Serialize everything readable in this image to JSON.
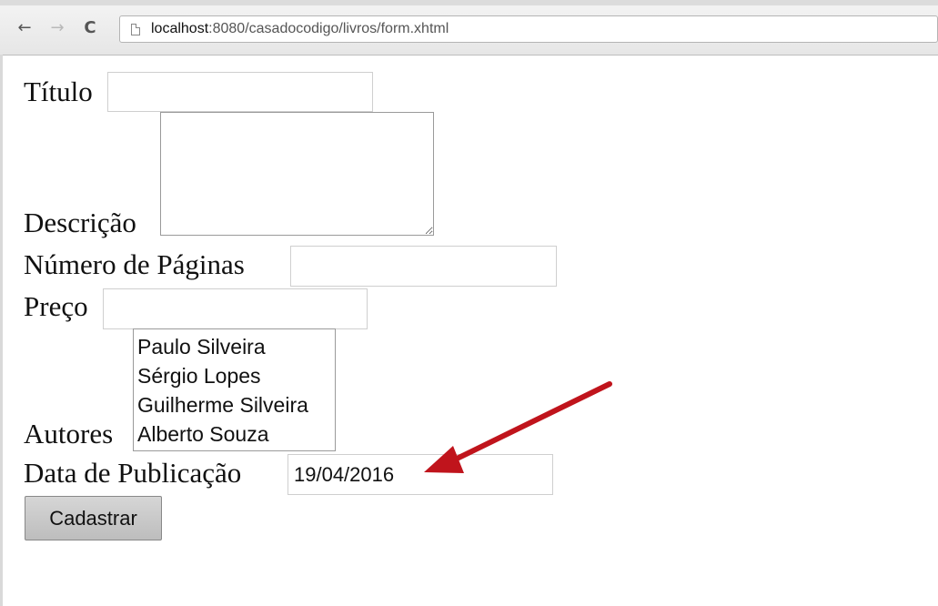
{
  "browser": {
    "back_icon": "←",
    "forward_icon": "→",
    "reload_icon": "C",
    "url_host": "localhost",
    "url_path": ":8080/casadocodigo/livros/form.xhtml"
  },
  "form": {
    "titulo_label": "Título",
    "titulo_value": "",
    "descricao_label": "Descrição",
    "descricao_value": "",
    "numero_paginas_label": "Número de Páginas",
    "numero_paginas_value": "",
    "preco_label": "Preço",
    "preco_value": "",
    "autores_label": "Autores",
    "autores_options": [
      "Paulo Silveira",
      "Sérgio Lopes",
      "Guilherme Silveira",
      "Alberto Souza"
    ],
    "data_publicacao_label": "Data de Publicação",
    "data_publicacao_value": "19/04/2016",
    "submit_label": "Cadastrar"
  },
  "colors": {
    "arrow": "#c0141c"
  }
}
